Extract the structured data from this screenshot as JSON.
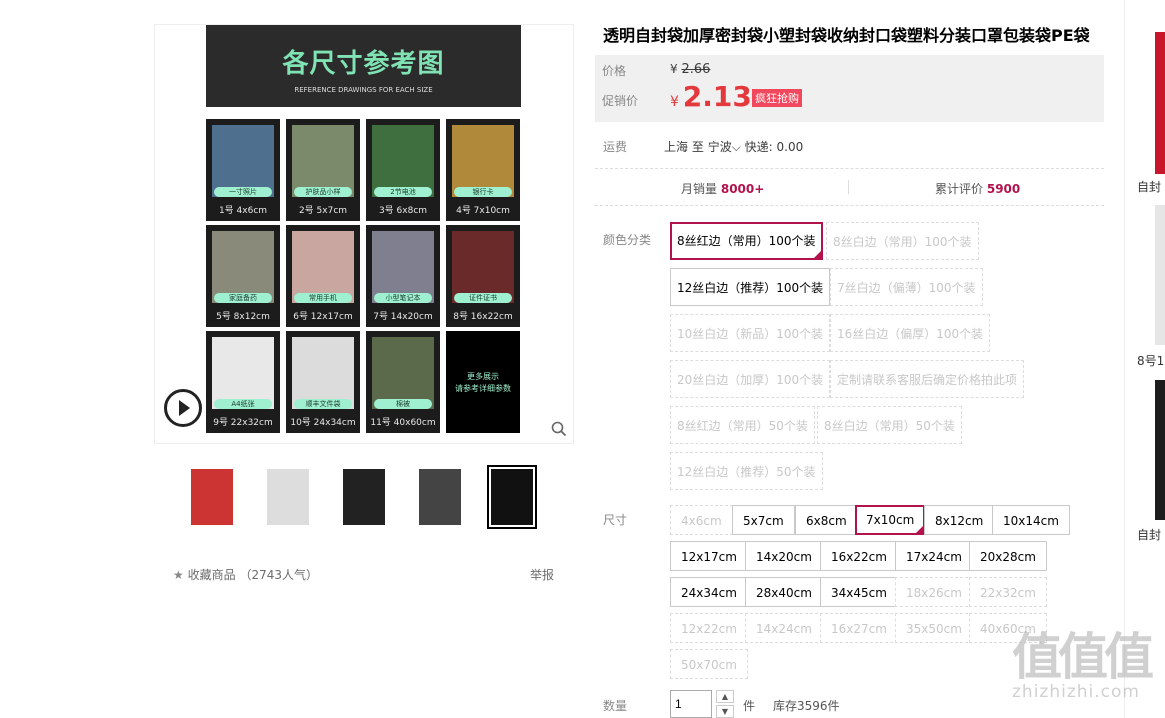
{
  "product": {
    "title": "透明自封袋加厚密封袋小塑封袋收纳封口袋塑料分装口罩包装袋PE袋"
  },
  "main_image": {
    "header_title": "各尺寸参考图",
    "header_subtitle": "REFERENCE DRAWINGS FOR EACH SIZE",
    "cells": [
      {
        "label": "一寸照片",
        "size": "1号  4x6cm",
        "color": "#4f6f8f"
      },
      {
        "label": "护肤品小样",
        "size": "2号  5x7cm",
        "color": "#7a8a6a"
      },
      {
        "label": "2节电池",
        "size": "3号  6x8cm",
        "color": "#3f6f3f"
      },
      {
        "label": "银行卡",
        "size": "4号  7x10cm",
        "color": "#b08a3a"
      },
      {
        "label": "家庭备药",
        "size": "5号  8x12cm",
        "color": "#8a8a7a"
      },
      {
        "label": "常用手机",
        "size": "6号  12x17cm",
        "color": "#c9a6a0"
      },
      {
        "label": "小型笔记本",
        "size": "7号  14x20cm",
        "color": "#7f7f8f"
      },
      {
        "label": "证件证书",
        "size": "8号  16x22cm",
        "color": "#6a2a2a"
      },
      {
        "label": "A4纸张",
        "size": "9号  22x32cm",
        "color": "#e8e8e8"
      },
      {
        "label": "顺丰文件袋",
        "size": "10号  24x34cm",
        "color": "#dcdcdc"
      },
      {
        "label": "棉被",
        "size": "11号  40x60cm",
        "color": "#5a6a4a"
      }
    ],
    "more_text_1": "更多展示",
    "more_text_2": "请参考详细参数"
  },
  "thumbnails": [
    {
      "color": "#c33"
    },
    {
      "color": "#ddd"
    },
    {
      "color": "#222"
    },
    {
      "color": "#444"
    },
    {
      "color": "#111"
    }
  ],
  "favorite": {
    "icon": "star-icon",
    "label": "收藏商品",
    "count": "（2743人气）"
  },
  "report_label": "举报",
  "price": {
    "label": "价格",
    "currency": "¥",
    "original": "2.66",
    "promo_label": "促销价",
    "promo": "2.13",
    "badge": "疯狂抢购"
  },
  "shipping": {
    "label": "运费",
    "from": "上海",
    "to_prefix": "至",
    "to": "宁波",
    "method": "快递: 0.00"
  },
  "stats": {
    "sales_label": "月销量",
    "sales": "8000+",
    "reviews_label": "累计评价",
    "reviews": "5900"
  },
  "color_section": {
    "label": "颜色分类",
    "options": [
      {
        "text": "8丝红边（常用）100个装",
        "state": "selected"
      },
      {
        "text": "8丝白边（常用）100个装",
        "state": "disabled"
      },
      {
        "text": "12丝白边（推荐）100个装",
        "state": "normal"
      },
      {
        "text": "7丝白边（偏薄）100个装",
        "state": "disabled"
      },
      {
        "text": "10丝白边（新品）100个装",
        "state": "disabled"
      },
      {
        "text": "16丝白边（偏厚）100个装",
        "state": "disabled"
      },
      {
        "text": "20丝白边（加厚）100个装",
        "state": "disabled"
      },
      {
        "text": "定制请联系客服后确定价格拍此项",
        "state": "disabled"
      },
      {
        "text": "8丝红边（常用）50个装",
        "state": "disabled"
      },
      {
        "text": "8丝白边（常用）50个装",
        "state": "disabled"
      },
      {
        "text": "12丝白边（推荐）50个装",
        "state": "disabled"
      }
    ]
  },
  "size_section": {
    "label": "尺寸",
    "options": [
      {
        "text": "4x6cm",
        "state": "disabled"
      },
      {
        "text": "5x7cm",
        "state": "normal"
      },
      {
        "text": "6x8cm",
        "state": "normal"
      },
      {
        "text": "7x10cm",
        "state": "selected"
      },
      {
        "text": "8x12cm",
        "state": "normal"
      },
      {
        "text": "10x14cm",
        "state": "normal"
      },
      {
        "text": "12x17cm",
        "state": "normal"
      },
      {
        "text": "14x20cm",
        "state": "normal"
      },
      {
        "text": "16x22cm",
        "state": "normal"
      },
      {
        "text": "17x24cm",
        "state": "normal"
      },
      {
        "text": "20x28cm",
        "state": "normal"
      },
      {
        "text": "24x34cm",
        "state": "normal"
      },
      {
        "text": "28x40cm",
        "state": "normal"
      },
      {
        "text": "34x45cm",
        "state": "normal"
      },
      {
        "text": "18x26cm",
        "state": "disabled"
      },
      {
        "text": "22x32cm",
        "state": "disabled"
      },
      {
        "text": "12x22cm",
        "state": "disabled"
      },
      {
        "text": "14x24cm",
        "state": "disabled"
      },
      {
        "text": "16x27cm",
        "state": "disabled"
      },
      {
        "text": "35x50cm",
        "state": "disabled"
      },
      {
        "text": "40x60cm",
        "state": "disabled"
      },
      {
        "text": "50x70cm",
        "state": "disabled"
      }
    ]
  },
  "quantity": {
    "label": "数量",
    "value": "1",
    "unit": "件",
    "stock": "库存3596件"
  },
  "side_recommendations": [
    {
      "caption": "自封"
    },
    {
      "caption": "8号1"
    },
    {
      "caption": "自封"
    }
  ],
  "watermark": {
    "big": "值值值",
    "small": "zhizhizhi.com"
  }
}
